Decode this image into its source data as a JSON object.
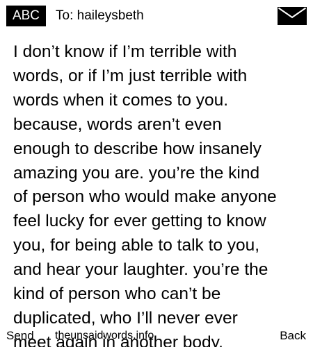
{
  "header": {
    "input_mode": "ABC",
    "recipient": "To: haileysbeth",
    "icon": "envelope-icon"
  },
  "message": {
    "text": "I don’t know if I’m terrible with\nwords, or if I’m just terrible with\nwords when it comes to you.\nbecause, words aren’t even\nenough to describe how insanely\namazing you are. you’re the kind\nof person who would make anyone\nfeel lucky for ever getting to know\nyou, for being able to talk to you,\nand hear your laughter. you’re the\nkind of person who can’t be\nduplicated, who I’ll never ever\nmeet again in another body."
  },
  "softkeys": {
    "left": "Send",
    "right": "Back"
  },
  "watermark": "theunsaidwords.info",
  "colors": {
    "background": "#ffffff",
    "text": "#000000",
    "badge": "#000000"
  }
}
